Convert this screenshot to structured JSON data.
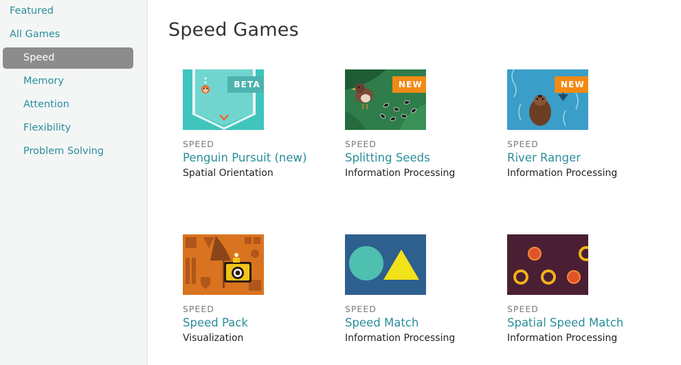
{
  "sidebar": {
    "items": [
      {
        "label": "Featured"
      },
      {
        "label": "All Games"
      },
      {
        "label": "Speed"
      },
      {
        "label": "Memory"
      },
      {
        "label": "Attention"
      },
      {
        "label": "Flexibility"
      },
      {
        "label": "Problem Solving"
      }
    ],
    "active": "Speed"
  },
  "main": {
    "title": "Speed Games",
    "games": [
      {
        "category": "SPEED",
        "title": "Penguin Pursuit (new)",
        "skill": "Spatial Orientation",
        "badge": "BETA"
      },
      {
        "category": "SPEED",
        "title": "Splitting Seeds",
        "skill": "Information Processing",
        "badge": "NEW"
      },
      {
        "category": "SPEED",
        "title": "River Ranger",
        "skill": "Information Processing",
        "badge": "NEW"
      },
      {
        "category": "SPEED",
        "title": "Speed Pack",
        "skill": "Visualization"
      },
      {
        "category": "SPEED",
        "title": "Speed Match",
        "skill": "Information Processing"
      },
      {
        "category": "SPEED",
        "title": "Spatial Speed Match",
        "skill": "Information Processing"
      }
    ]
  },
  "colors": {
    "link": "#2a8d9a",
    "active_nav_bg": "#8c8c8c",
    "badge_beta": "#4cb3ae",
    "badge_new": "#f28a15"
  }
}
